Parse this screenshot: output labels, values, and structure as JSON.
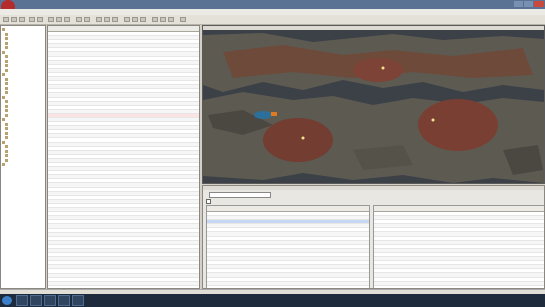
{
  "app": {
    "logo_text": "",
    "title": ""
  },
  "tree": {
    "items": [
      "",
      "",
      "",
      "",
      "",
      "",
      "",
      "",
      "",
      "",
      "",
      "",
      "",
      "",
      "",
      "",
      "",
      "",
      "",
      "",
      "",
      "",
      "",
      "",
      "",
      "",
      "",
      "",
      "",
      "",
      ""
    ]
  },
  "object_window": {
    "filter_value": "",
    "row_count": 63
  },
  "render_window": {
    "title": "",
    "status": ""
  },
  "cell_view": {
    "title": "",
    "worldspace_label": "",
    "worldspace_value": "",
    "loaded_checkbox_label": "",
    "x_label": "",
    "y_label": "",
    "columns_left": [
      "",
      "",
      "",
      ""
    ],
    "columns_right": [
      "",
      "",
      "",
      "",
      "",
      "",
      ""
    ],
    "selected_cell_heading": ""
  },
  "status_bar": {
    "text1": "",
    "text2": "",
    "text3": ""
  },
  "taskbar": {
    "clock": ""
  },
  "colors": {
    "titlebar": "#5a7394",
    "viewport_bg": "#3b4147",
    "rock": "#5d5a52",
    "terrain_red": "#7a3f33",
    "water": "#2c6f9a",
    "selection_blue": "#c5d7f2",
    "taskbar": "#1e2b3c"
  }
}
